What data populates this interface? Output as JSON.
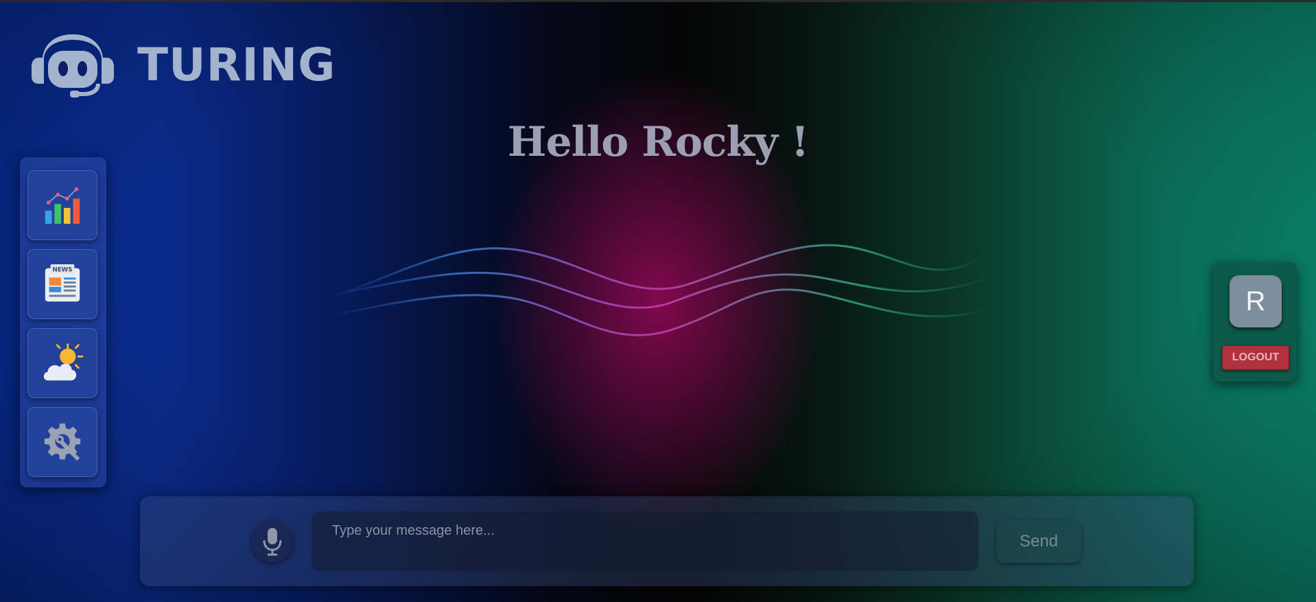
{
  "app": {
    "logo_text": "TURING",
    "logo_icon": "robot-headset-icon"
  },
  "greeting": "Hello Rocky !",
  "sidebar": {
    "items": [
      {
        "name": "analytics",
        "icon": "bar-chart-icon"
      },
      {
        "name": "news",
        "icon": "newspaper-icon",
        "icon_text": "NEWS"
      },
      {
        "name": "weather",
        "icon": "weather-icon"
      },
      {
        "name": "settings",
        "icon": "gear-wrench-icon"
      }
    ]
  },
  "user": {
    "avatar_initial": "R",
    "logout_label": "LOGOUT"
  },
  "chat": {
    "placeholder": "Type your message here...",
    "send_label": "Send",
    "mic_icon": "microphone-icon"
  },
  "colors": {
    "accent_blue": "#22419a",
    "accent_green": "#0d5a4a",
    "logout_red": "#b1323d",
    "logo_color": "#a3b3cd"
  }
}
